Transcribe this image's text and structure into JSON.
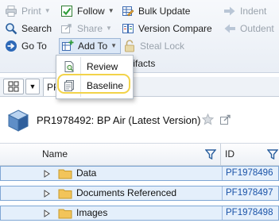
{
  "toolbar": {
    "print_label": "Print",
    "follow_label": "Follow",
    "bulk_update_label": "Bulk Update",
    "indent_label": "Indent",
    "search_label": "Search",
    "share_label": "Share",
    "version_compare_label": "Version Compare",
    "outdent_label": "Outdent",
    "goto_label": "Go To",
    "add_to_label": "Add To",
    "steal_lock_label": "Steal Lock",
    "artifacts_partial_label": "tifacts"
  },
  "add_to_menu": {
    "items": [
      {
        "label": "Review",
        "icon": "review-icon"
      },
      {
        "label": "Baseline",
        "icon": "baseline-icon",
        "highlighted": true
      }
    ]
  },
  "tabs": {
    "active_partial_label": "PR"
  },
  "object_header": {
    "title": "PR1978492: BP Air (Latest Version)",
    "icon": "cube-icon",
    "actions": [
      "favorite-star-icon",
      "share-icon"
    ]
  },
  "grid": {
    "columns": [
      "Name",
      "ID"
    ],
    "rows": [
      {
        "name": "Data",
        "id": "PF1978496"
      },
      {
        "name": "Documents Referenced",
        "id": "PF1978497"
      },
      {
        "name": "Images",
        "id": "PF1978498"
      }
    ]
  },
  "colors": {
    "toolbar_bg": "#eef2f7",
    "row_bg": "#e4effb",
    "row_border": "#7fa6d4",
    "id_link": "#1a53a8",
    "highlight_ring": "#f2d34a",
    "folder": "#f2c45a"
  }
}
